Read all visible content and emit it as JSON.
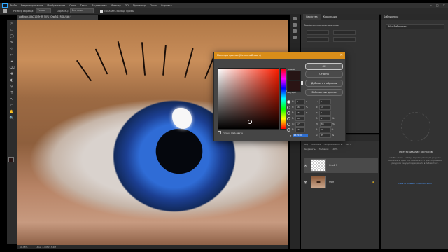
{
  "menu": {
    "items": [
      "Файл",
      "Редактирование",
      "Изображение",
      "Слои",
      "Текст",
      "Выделение",
      "Фильтр",
      "3D",
      "Просмотр",
      "Окно",
      "Справка"
    ]
  },
  "window": {
    "minimize": "–",
    "maximize": "□",
    "close": "✕"
  },
  "options_bar": {
    "sample_size_label": "Размер образца:",
    "sample_size_value": "Точка",
    "sample_label": "Образец:",
    "sample_value": "Все слои",
    "show_ring_label": "Показать кольцо пробы"
  },
  "document": {
    "tab_title": "шаблон-18b210@r @ 50% (Слой 1, RGB/8#) *",
    "zoom": "50,78%",
    "doc_info": "Док: 4,00M/13,4M"
  },
  "tools": [
    "⤧",
    "▭",
    "◯",
    "✎",
    "⊹",
    "✂",
    "⌖",
    "⌫",
    "✚",
    "◐",
    "⚲",
    "T",
    "↖",
    "▭",
    "✋",
    "🔍",
    "…"
  ],
  "properties": {
    "tabs": [
      "Свойства",
      "Коррекция"
    ],
    "title": "Свойства пиксельного слоя"
  },
  "libraries": {
    "header": "Библиотеки",
    "select": "Моя библиотека",
    "empty_title": "Перетаскивание ресурсов",
    "empty_text": "Чтобы начать работу, перетащите сюда ресурсы любой категории или нажмите «+» для сохранения ресурсов текущего документа в библиотеку.",
    "link": "Узнать больше о библиотеках"
  },
  "layers": {
    "header": "Слои",
    "kind_label": "Вид",
    "blend_mode": "Обычные",
    "opacity_label": "Непрозрачность:",
    "opacity_value": "100%",
    "lock_label": "Закрепить:",
    "fill_label": "Заливка:",
    "fill_value": "100%",
    "items": [
      {
        "name": "Слой 1",
        "thumb": "transparent",
        "visible": true,
        "selected": true
      },
      {
        "name": "Фон",
        "thumb": "photo",
        "visible": true,
        "selected": false,
        "locked": true
      }
    ]
  },
  "color_picker": {
    "title": "Палитра цветов (Основной цвет)",
    "new_label": "новый",
    "current_label": "текущий",
    "ok": "ОК",
    "cancel": "Отмена",
    "add_swatch": "Добавить в образцы",
    "libraries": "Библиотеки цветов",
    "hsb": [
      {
        "label": "H:",
        "value": "4",
        "unit": "°"
      },
      {
        "label": "S:",
        "value": "56",
        "unit": "%"
      },
      {
        "label": "B:",
        "value": "15",
        "unit": "%"
      }
    ],
    "rgb": [
      {
        "label": "R:",
        "value": "38",
        "unit": ""
      },
      {
        "label": "G:",
        "value": "17",
        "unit": ""
      },
      {
        "label": "B:",
        "value": "16",
        "unit": ""
      }
    ],
    "lab": [
      {
        "label": "L:",
        "value": "8",
        "unit": ""
      },
      {
        "label": "a:",
        "value": "11",
        "unit": ""
      },
      {
        "label": "b:",
        "value": "6",
        "unit": ""
      }
    ],
    "cmyk": [
      {
        "label": "C:",
        "value": "57",
        "unit": "%"
      },
      {
        "label": "M:",
        "value": "84",
        "unit": "%"
      },
      {
        "label": "Y:",
        "value": "79",
        "unit": "%"
      },
      {
        "label": "K:",
        "value": "85",
        "unit": "%"
      }
    ],
    "web_only": "Только Web-цвета",
    "hex_label": "#",
    "hex": "261510",
    "colors": {
      "new": "#261510",
      "current": "#2a1414",
      "title_bar": "#d98d19"
    }
  }
}
